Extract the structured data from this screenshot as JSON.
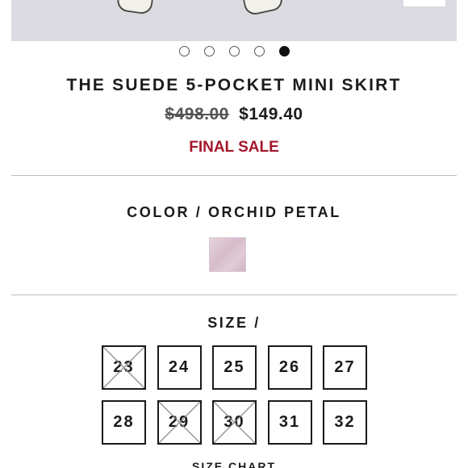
{
  "carousel": {
    "total_slides": 5,
    "active_index": 4
  },
  "product": {
    "title": "THE SUEDE 5-POCKET MINI SKIRT",
    "original_price": "$498.00",
    "sale_price": "$149.40",
    "sale_note": "FINAL SALE"
  },
  "color": {
    "label": "COLOR / ORCHID PETAL",
    "swatch_color": "#dcc3d1"
  },
  "size": {
    "label": "SIZE /",
    "options": [
      {
        "value": "23",
        "available": false
      },
      {
        "value": "24",
        "available": true
      },
      {
        "value": "25",
        "available": true
      },
      {
        "value": "26",
        "available": true
      },
      {
        "value": "27",
        "available": true
      },
      {
        "value": "28",
        "available": true
      },
      {
        "value": "29",
        "available": false
      },
      {
        "value": "30",
        "available": false
      },
      {
        "value": "31",
        "available": true
      },
      {
        "value": "32",
        "available": true
      }
    ],
    "chart_link": "SIZE CHART"
  },
  "colors": {
    "sale_red": "#a3172b",
    "divider": "#bdbdbd",
    "hero_bg": "#dcdbe1"
  }
}
